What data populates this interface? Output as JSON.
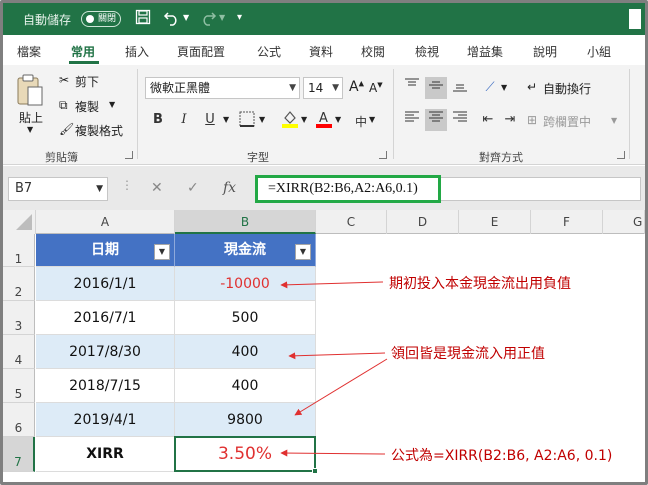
{
  "titlebar": {
    "autosave_label": "自動儲存",
    "autosave_state": "關閉"
  },
  "tabs": [
    "檔案",
    "常用",
    "插入",
    "頁面配置",
    "公式",
    "資料",
    "校閱",
    "檢視",
    "增益集",
    "說明",
    "小組"
  ],
  "ribbon": {
    "clipboard": {
      "paste": "貼上",
      "cut": "剪下",
      "copy": "複製",
      "format_painter": "複製格式",
      "label": "剪貼簿"
    },
    "font": {
      "name": "微軟正黑體",
      "size": "14",
      "bold": "B",
      "italic": "I",
      "underline": "U",
      "label": "字型",
      "phonetic": "中"
    },
    "alignment": {
      "wrap_text": "自動換行",
      "merge": "跨欄置中",
      "label": "對齊方式"
    }
  },
  "formula_bar": {
    "name_box": "B7",
    "formula": "=XIRR(B2:B6,A2:A6,0.1)"
  },
  "columns": [
    "A",
    "B",
    "C",
    "D",
    "E",
    "F",
    "G"
  ],
  "rows": [
    "1",
    "2",
    "3",
    "4",
    "5",
    "6",
    "7"
  ],
  "table": {
    "headers": [
      "日期",
      "現金流"
    ],
    "rows": [
      [
        "2016/1/1",
        "-10000"
      ],
      [
        "2016/7/1",
        "500"
      ],
      [
        "2017/8/30",
        "400"
      ],
      [
        "2018/7/15",
        "400"
      ],
      [
        "2019/4/1",
        "9800"
      ]
    ],
    "result_label": "XIRR",
    "result_value": "3.50%"
  },
  "annotations": {
    "note1": "期初投入本金現金流出用負值",
    "note2": "領回皆是現金流入用正值",
    "note3": "公式為=XIRR(B2:B6, A2:A6, 0.1)"
  },
  "colors": {
    "excel_green": "#217346",
    "table_header": "#4472c4",
    "band": "#ddebf7",
    "accent_red": "#c00000",
    "formula_highlight": "#22a845"
  }
}
